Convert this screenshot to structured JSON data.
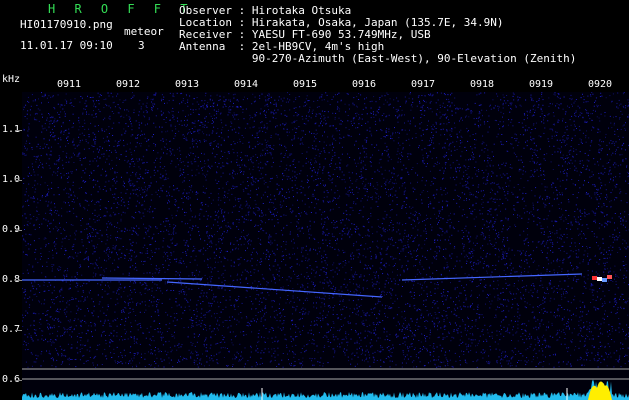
{
  "header": {
    "app_title": "H R O F F T",
    "filename": "HI01170910.png",
    "datetime": "11.01.17 09:10",
    "meteor_label": "meteor",
    "meteor_count": "3",
    "observer": "Observer : Hirotaka Otsuka",
    "location": "Location : Hirakata, Osaka, Japan (135.7E, 34.9N)",
    "receiver": "Receiver : YAESU FT-690 53.749MHz, USB",
    "antenna": "Antenna  : 2el-HB9CV, 4m's high",
    "antenna2": "           90-270-Azimuth (East-West), 90-Elevation (Zenith)"
  },
  "axis": {
    "y_unit": "kHz",
    "y_ticks": [
      "1.1",
      "1.0",
      "0.9",
      "0.8",
      "0.7",
      "0.6"
    ],
    "x_ticks": [
      "0911",
      "0912",
      "0913",
      "0914",
      "0915",
      "0916",
      "0917",
      "0918",
      "0919",
      "0920"
    ]
  },
  "colors": {
    "background": "#000000",
    "title": "#33dd55",
    "noise": "#1a1aa0",
    "trail": "#4466ff"
  }
}
